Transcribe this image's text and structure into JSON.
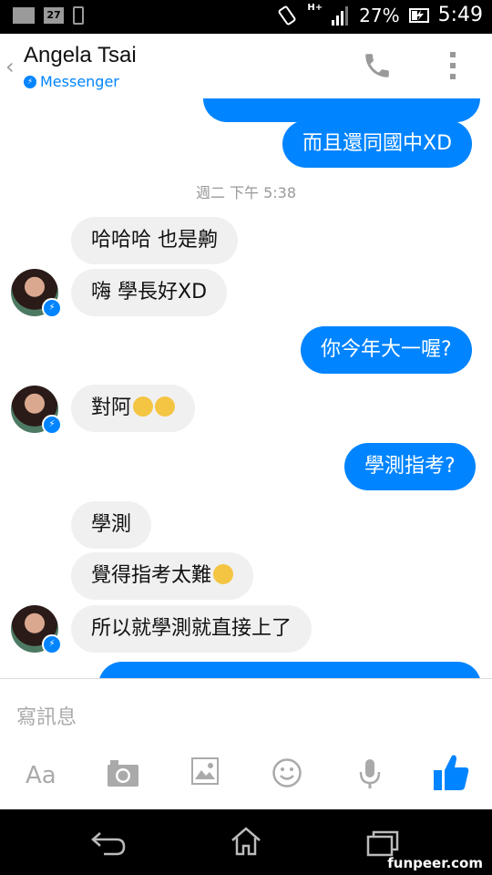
{
  "status": {
    "battery": "27%",
    "time": "5:49",
    "calendar_day": "27",
    "network": "H+"
  },
  "header": {
    "title": "Angela Tsai",
    "subtitle": "Messenger"
  },
  "messages": [
    {
      "id": "m0",
      "dir": "out",
      "text": ""
    },
    {
      "id": "m1",
      "dir": "out",
      "text": "而且還同國中XD"
    },
    {
      "id": "t1",
      "type": "time",
      "text": "週二 下午 5:38"
    },
    {
      "id": "m2",
      "dir": "in",
      "text": "哈哈哈 也是齁"
    },
    {
      "id": "m3",
      "dir": "in",
      "text": "嗨 學長好XD"
    },
    {
      "id": "m4",
      "dir": "out",
      "text": "你今年大一喔?"
    },
    {
      "id": "m5",
      "dir": "in",
      "text": "對阿"
    },
    {
      "id": "m6",
      "dir": "out",
      "text": "學測指考?"
    },
    {
      "id": "m7",
      "dir": "in",
      "text": "學測"
    },
    {
      "id": "m8",
      "dir": "in",
      "text": "覺得指考太難"
    },
    {
      "id": "m9",
      "dir": "in",
      "text": "所以就學測就直接上了"
    },
    {
      "id": "m10",
      "dir": "out",
      "text": ""
    }
  ],
  "composer": {
    "placeholder": "寫訊息",
    "aa_label": "Aa"
  },
  "icons": {
    "accent": "#0084ff",
    "names": [
      "back-chevron-icon",
      "messenger-icon",
      "phone-call-icon",
      "more-vert-icon",
      "camera-icon",
      "image-icon",
      "emoji-icon",
      "mic-icon",
      "thumbs-up-icon",
      "nav-back-icon",
      "nav-home-icon",
      "nav-recents-icon"
    ]
  },
  "watermark": "funpeer.com"
}
